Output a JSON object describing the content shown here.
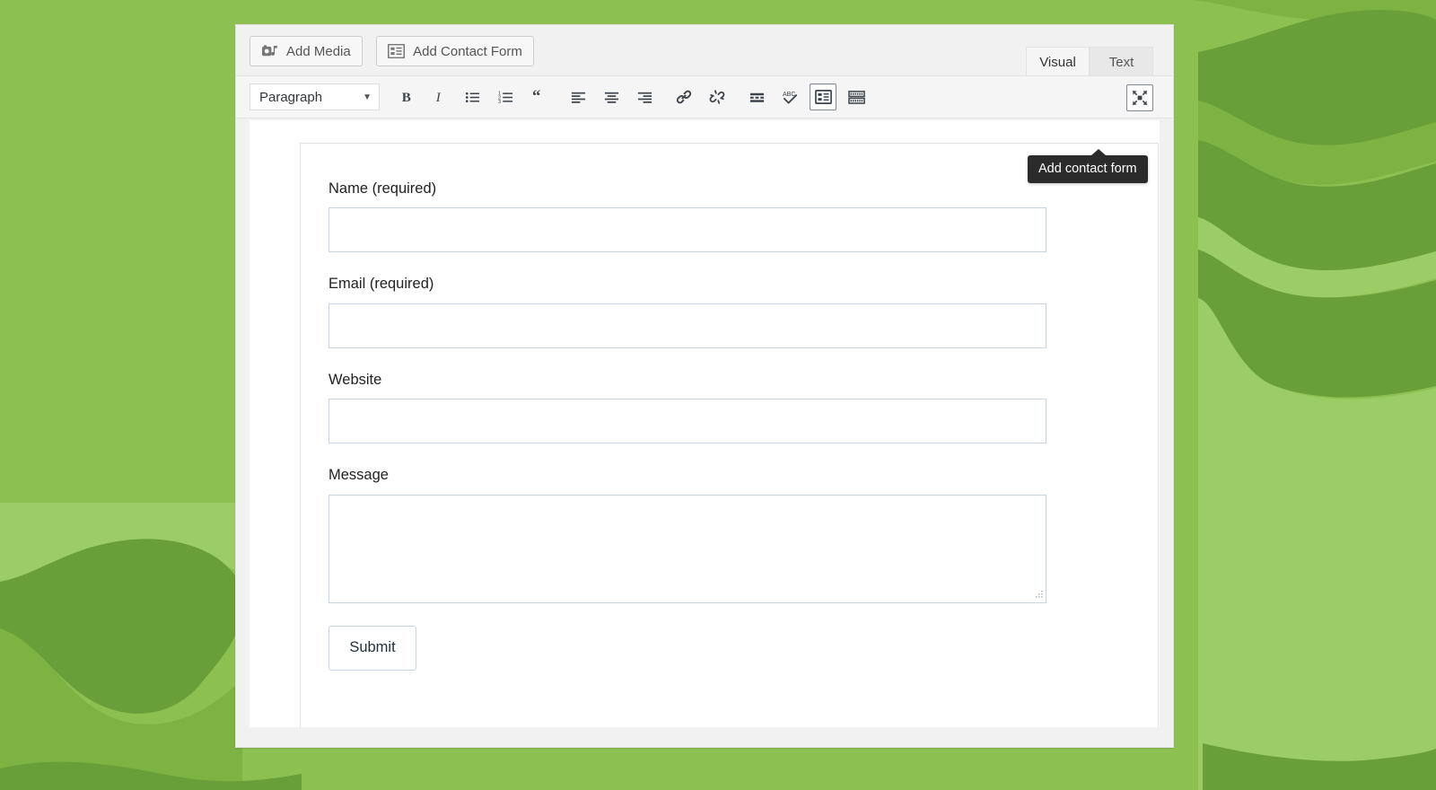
{
  "page": {
    "background_color": "#8cc152",
    "background_shape_colors": [
      "#7cb342",
      "#689f38",
      "#9ccc65"
    ]
  },
  "editor": {
    "media_bar": {
      "add_media": {
        "label": "Add Media",
        "icon": "add-media-icon"
      },
      "add_contact_form": {
        "label": "Add Contact Form",
        "icon": "contact-form-icon"
      }
    },
    "tabs": [
      {
        "label": "Visual",
        "active": true
      },
      {
        "label": "Text",
        "active": false
      }
    ],
    "format_bar": {
      "style_select": {
        "value": "Paragraph",
        "caret": "▼"
      },
      "buttons": [
        {
          "name": "bold",
          "title": "Bold",
          "active": false
        },
        {
          "name": "italic",
          "title": "Italic",
          "active": false
        },
        {
          "name": "bulleted-list",
          "title": "Bulleted list",
          "active": false
        },
        {
          "name": "numbered-list",
          "title": "Numbered list",
          "active": false
        },
        {
          "name": "blockquote",
          "title": "Blockquote",
          "active": false
        },
        {
          "name": "align-left",
          "title": "Align left",
          "active": false
        },
        {
          "name": "align-center",
          "title": "Align center",
          "active": false
        },
        {
          "name": "align-right",
          "title": "Align right",
          "active": false
        },
        {
          "name": "insert-link",
          "title": "Insert link",
          "active": false
        },
        {
          "name": "remove-link",
          "title": "Remove link",
          "active": false
        },
        {
          "name": "read-more",
          "title": "Insert Read More tag",
          "active": false
        },
        {
          "name": "spellcheck",
          "title": "Spellcheck",
          "active": false
        },
        {
          "name": "contact-form",
          "title": "Add contact form",
          "active": true
        },
        {
          "name": "keyboard-shortcuts",
          "title": "Keyboard shortcuts",
          "active": false
        }
      ],
      "fullscreen": {
        "name": "fullscreen",
        "title": "Distraction-free writing mode"
      }
    },
    "tooltip": {
      "text": "Add contact form",
      "target": "contact-form-toolbar-button"
    }
  },
  "contact_form": {
    "fields": [
      {
        "label": "Name (required)",
        "type": "text",
        "value": "",
        "placeholder": ""
      },
      {
        "label": "Email (required)",
        "type": "text",
        "value": "",
        "placeholder": ""
      },
      {
        "label": "Website",
        "type": "text",
        "value": "",
        "placeholder": ""
      },
      {
        "label": "Message",
        "type": "textarea",
        "value": "",
        "placeholder": ""
      }
    ],
    "submit": {
      "label": "Submit"
    }
  }
}
